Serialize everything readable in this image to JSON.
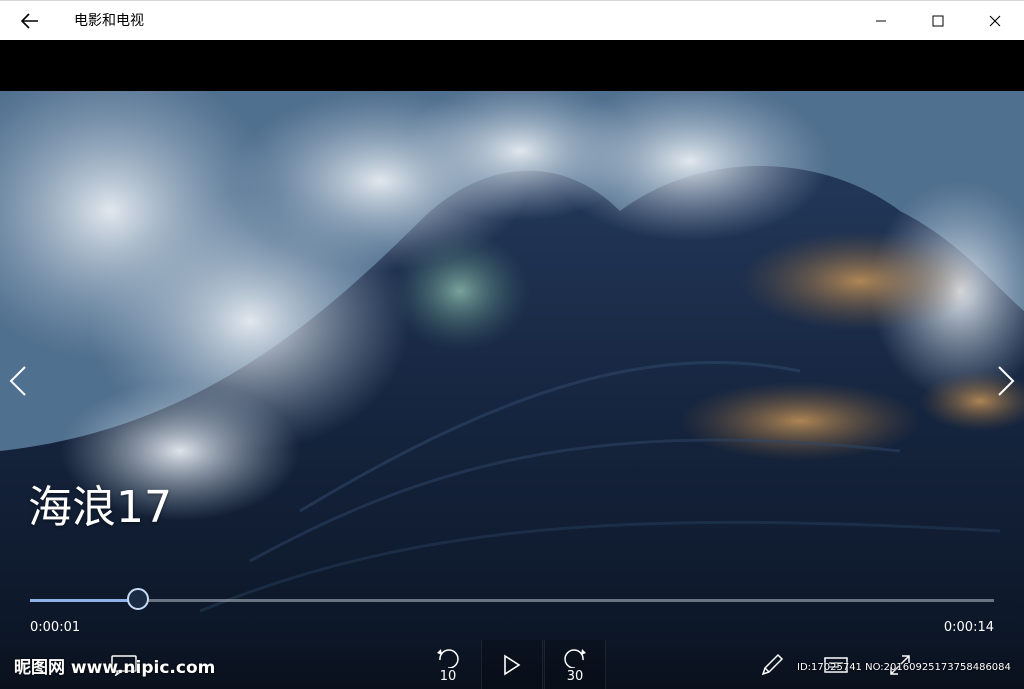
{
  "titlebar": {
    "app_title": "电影和电视",
    "back_icon": "arrow-left-icon",
    "minimize_icon": "minimize-icon",
    "maximize_icon": "maximize-icon",
    "close_icon": "close-icon"
  },
  "video": {
    "title": "海浪17",
    "prev_icon": "chevron-left-icon",
    "next_icon": "chevron-right-icon"
  },
  "playback": {
    "current_time": "0:00:01",
    "total_time": "0:00:14",
    "progress_fraction": 0.112
  },
  "controls": {
    "rewind_seconds": "10",
    "forward_seconds": "30",
    "play_icon": "play-icon",
    "subtitles_icon": "subtitles-icon",
    "edit_icon": "pencil-icon",
    "cast_icon": "cast-icon",
    "fullscreen_icon": "fullscreen-icon"
  },
  "watermark": {
    "site": "昵图网 www.nipic.com",
    "id_text": "ID:17025741 NO:20160925173758486084"
  },
  "colors": {
    "titlebar_bg": "#ffffff",
    "seek_fill": "#8fb3e8",
    "seek_track": "#8c97a3"
  }
}
